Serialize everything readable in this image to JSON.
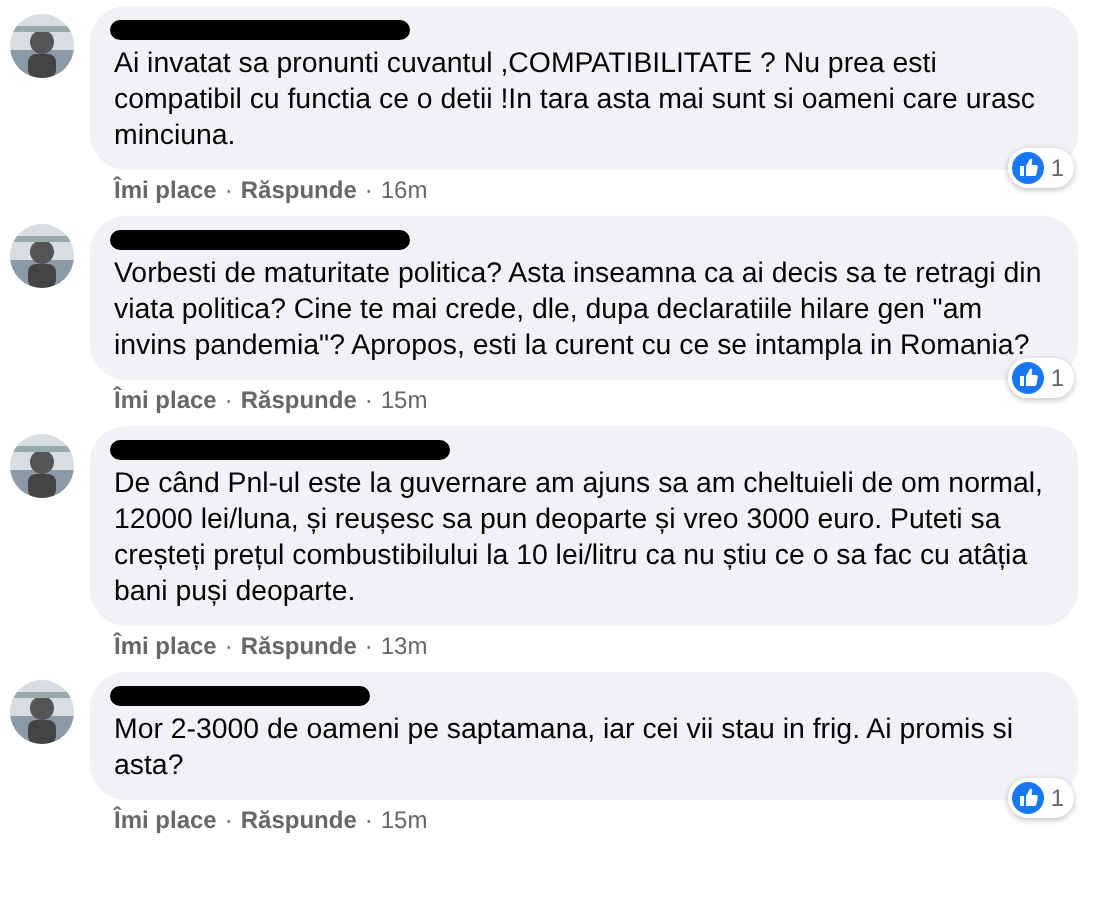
{
  "separator": "·",
  "comments": [
    {
      "text": "Ai invatat sa pronunti cuvantul ,COMPATIBILITATE ? Nu prea esti compatibil cu functia ce o detii !In tara asta mai sunt si oameni care urasc minciuna.",
      "like": "Îmi place",
      "reply": "Răspunde",
      "time": "16m",
      "reactions": "1"
    },
    {
      "text": "Vorbesti de maturitate politica? Asta inseamna ca ai decis sa te retragi din viata politica? Cine te mai crede, dle, dupa declaratiile hilare gen \"am invins pandemia\"? Apropos, esti la curent cu ce se intampla in Romania?",
      "like": "Îmi place",
      "reply": "Răspunde",
      "time": "15m",
      "reactions": "1"
    },
    {
      "text": "De când Pnl-ul este la guvernare am ajuns sa am cheltuieli de om normal, 12000 lei/luna, și reușesc sa pun deoparte și vreo 3000 euro. Puteti sa creșteți prețul combustibilului la 10 lei/litru ca nu știu ce o sa fac cu atâția bani puși deoparte.",
      "like": "Îmi place",
      "reply": "Răspunde",
      "time": "13m"
    },
    {
      "text": "Mor 2-3000 de oameni pe saptamana, iar cei vii stau in frig. Ai promis si asta?",
      "like": "Îmi place",
      "reply": "Răspunde",
      "time": "15m",
      "reactions": "1"
    }
  ]
}
